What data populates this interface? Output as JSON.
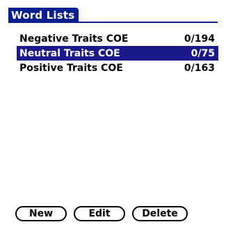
{
  "header": {
    "title": "Word Lists"
  },
  "lists": [
    {
      "name": "Negative Traits COE",
      "count": "0/194",
      "selected": false
    },
    {
      "name": "Neutral Traits COE",
      "count": "0/75",
      "selected": true
    },
    {
      "name": "Positive Traits COE",
      "count": "0/163",
      "selected": false
    }
  ],
  "toolbar": {
    "new_label": "New",
    "edit_label": "Edit",
    "delete_label": "Delete"
  },
  "colors": {
    "title_bar": "#0a1f8f",
    "selection": "#1a1a8c",
    "background": "#ffffff",
    "text": "#000000"
  }
}
